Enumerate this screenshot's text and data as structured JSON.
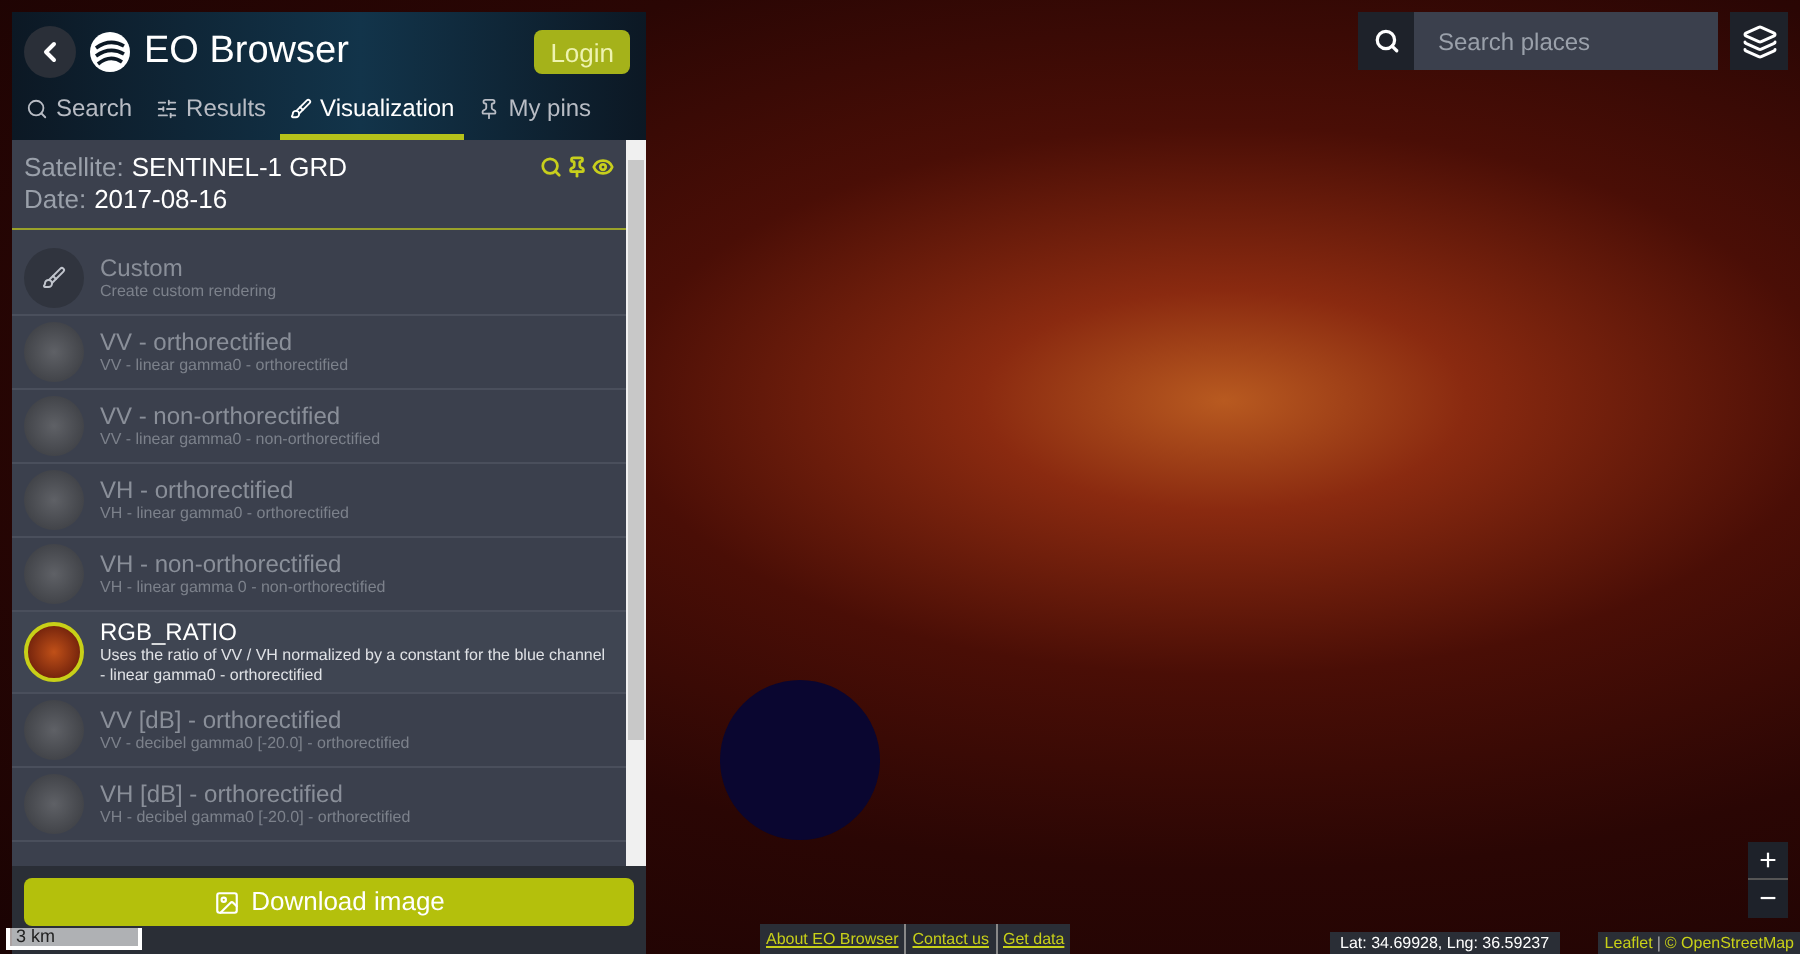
{
  "header": {
    "title": "EO Browser",
    "login": "Login"
  },
  "tabs": [
    {
      "label": "Search",
      "selected": false
    },
    {
      "label": "Results",
      "selected": false
    },
    {
      "label": "Visualization",
      "selected": true
    },
    {
      "label": "My pins",
      "selected": false
    }
  ],
  "info": {
    "satellite_label": "Satellite:",
    "satellite": "SENTINEL-1 GRD",
    "date_label": "Date:",
    "date": "2017-08-16"
  },
  "layers": [
    {
      "kind": "custom",
      "name": "Custom",
      "description": "Create custom rendering",
      "selected": false
    },
    {
      "kind": "preset",
      "name": "VV - orthorectified",
      "description": "VV - linear gamma0 - orthorectified",
      "selected": false
    },
    {
      "kind": "preset",
      "name": "VV - non-orthorectified",
      "description": "VV - linear gamma0 - non-orthorectified",
      "selected": false
    },
    {
      "kind": "preset",
      "name": "VH - orthorectified",
      "description": "VH - linear gamma0 - orthorectified",
      "selected": false
    },
    {
      "kind": "preset",
      "name": "VH - non-orthorectified",
      "description": "VH - linear gamma 0 - non-orthorectified",
      "selected": false
    },
    {
      "kind": "preset",
      "name": "RGB_RATIO",
      "description": "Uses the ratio of VV / VH normalized by a constant for the blue channel - linear gamma0 - orthorectified",
      "selected": true
    },
    {
      "kind": "preset",
      "name": "VV [dB] - orthorectified",
      "description": "VV - decibel gamma0 [-20.0] - orthorectified",
      "selected": false
    },
    {
      "kind": "preset",
      "name": "VH [dB] - orthorectified",
      "description": "VH - decibel gamma0 [-20.0] - orthorectified",
      "selected": false
    }
  ],
  "download": "Download image",
  "scale": "3 km",
  "search": {
    "placeholder": "Search places"
  },
  "zoom": {
    "in": "+",
    "out": "−"
  },
  "footer_links": [
    "About EO Browser",
    "Contact us",
    "Get data"
  ],
  "coordinates": "Lat: 34.69928, Lng: 36.59237",
  "attribution": {
    "leaflet": "Leaflet",
    "separator": "|",
    "osm": "© OpenStreetMap"
  }
}
